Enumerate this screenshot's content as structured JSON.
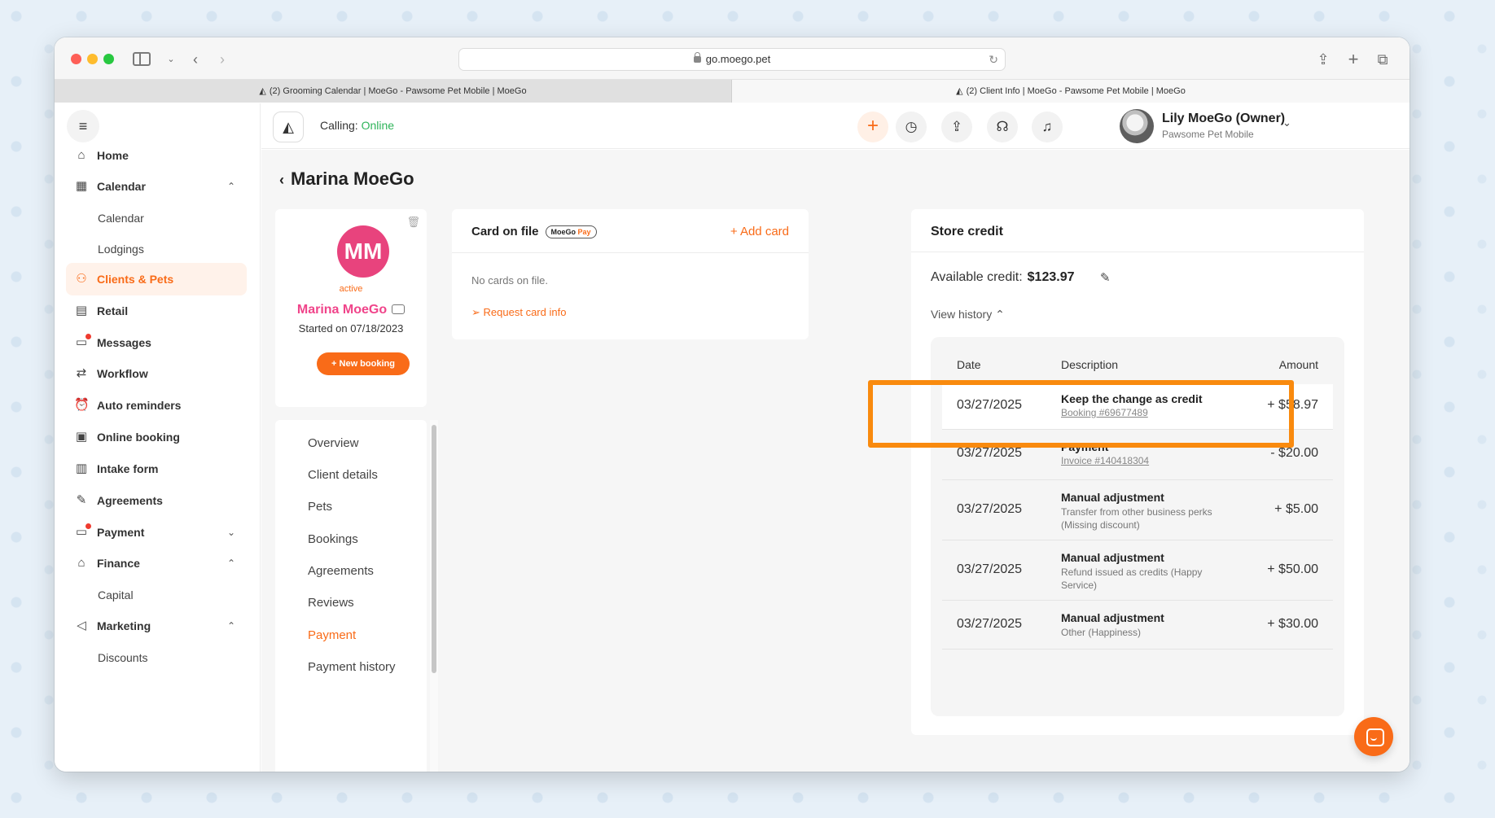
{
  "browser": {
    "url": "go.moego.pet",
    "tabs": [
      {
        "label": "(2) Grooming Calendar | MoeGo - Pawsome Pet Mobile | MoeGo"
      },
      {
        "label": "(2) Client Info | MoeGo - Pawsome Pet Mobile | MoeGo"
      }
    ]
  },
  "sidebar": {
    "items": [
      {
        "label": "Home",
        "icon": "home-icon"
      },
      {
        "label": "Calendar",
        "icon": "calendar-icon"
      },
      {
        "label": "Calendar"
      },
      {
        "label": "Lodgings"
      },
      {
        "label": "Clients & Pets",
        "icon": "clients-icon"
      },
      {
        "label": "Retail",
        "icon": "retail-icon"
      },
      {
        "label": "Messages",
        "icon": "messages-icon"
      },
      {
        "label": "Workflow",
        "icon": "workflow-icon"
      },
      {
        "label": "Auto reminders",
        "icon": "alarm-icon"
      },
      {
        "label": "Online booking",
        "icon": "online-booking-icon"
      },
      {
        "label": "Intake form",
        "icon": "clipboard-icon"
      },
      {
        "label": "Agreements",
        "icon": "pen-icon"
      },
      {
        "label": "Payment",
        "icon": "payment-icon"
      },
      {
        "label": "Finance",
        "icon": "bank-icon"
      },
      {
        "label": "Capital"
      },
      {
        "label": "Marketing",
        "icon": "megaphone-icon"
      },
      {
        "label": "Discounts"
      }
    ]
  },
  "header": {
    "calling_label": "Calling:",
    "calling_status": "Online",
    "user_name": "Lily MoeGo (Owner)",
    "business": "Pawsome Pet Mobile"
  },
  "page": {
    "title": "Marina MoeGo"
  },
  "profile": {
    "initials": "MM",
    "status": "active",
    "name": "Marina MoeGo",
    "started": "Started on 07/18/2023",
    "new_booking": "+ New booking"
  },
  "client_menu": [
    {
      "label": "Overview"
    },
    {
      "label": "Client details"
    },
    {
      "label": "Pets"
    },
    {
      "label": "Bookings"
    },
    {
      "label": "Agreements"
    },
    {
      "label": "Reviews"
    },
    {
      "label": "Payment"
    },
    {
      "label": "Payment history"
    }
  ],
  "card_on_file": {
    "title": "Card on file",
    "badge_prefix": "MoeGo",
    "badge_suffix": "Pay",
    "add_card": "+ Add card",
    "empty": "No cards on file.",
    "request": "Request card info"
  },
  "store_credit": {
    "title": "Store credit",
    "available_label": "Available credit:",
    "available_amount": "$123.97",
    "view_history": "View history",
    "columns": {
      "date": "Date",
      "description": "Description",
      "amount": "Amount"
    },
    "rows": [
      {
        "date": "03/27/2025",
        "title": "Keep the change as credit",
        "link": "Booking #69677489",
        "sub": "",
        "amount": "+ $58.97"
      },
      {
        "date": "03/27/2025",
        "title": "Payment",
        "link": "Invoice #140418304",
        "sub": "",
        "amount": "- $20.00"
      },
      {
        "date": "03/27/2025",
        "title": "Manual adjustment",
        "link": "",
        "sub": "Transfer from other business perks (Missing discount)",
        "amount": "+ $5.00"
      },
      {
        "date": "03/27/2025",
        "title": "Manual adjustment",
        "link": "",
        "sub": "Refund issued as credits (Happy Service)",
        "amount": "+ $50.00"
      },
      {
        "date": "03/27/2025",
        "title": "Manual adjustment",
        "link": "",
        "sub": "Other (Happiness)",
        "amount": "+ $30.00"
      }
    ]
  },
  "colors": {
    "accent": "#f96b18",
    "highlight": "#f98a0e",
    "online": "#2fb45a",
    "avatar": "#e8437d"
  }
}
